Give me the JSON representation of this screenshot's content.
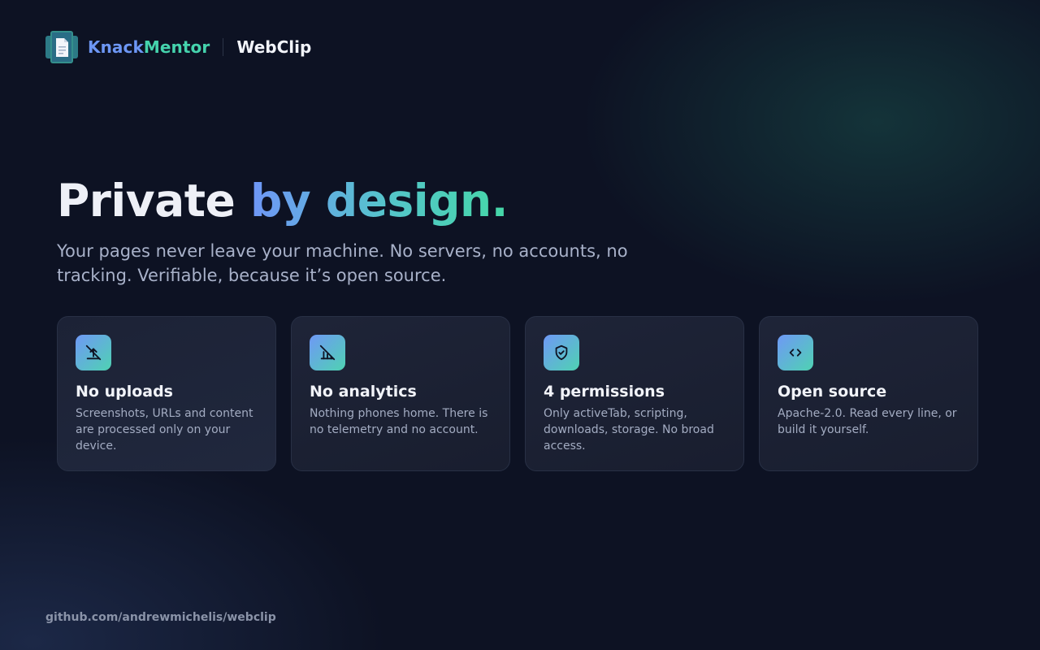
{
  "header": {
    "brand_part1": "Knack",
    "brand_part2": "Mentor",
    "product": "WebClip",
    "logo_icon": "document-logo-icon"
  },
  "hero": {
    "title_plain": "Private ",
    "title_accent": "by design.",
    "subtitle": "Your pages never leave your machine. No servers, no accounts, no tracking. Verifiable, because it’s open source."
  },
  "cards": [
    {
      "icon": "no-upload-icon",
      "title": "No uploads",
      "description": "Screenshots, URLs and content are processed only on your device."
    },
    {
      "icon": "no-analytics-icon",
      "title": "No analytics",
      "description": "Nothing phones home. There is no telemetry and no account."
    },
    {
      "icon": "shield-check-icon",
      "title": "4 permissions",
      "description": "Only activeTab, scripting, downloads, storage. No broad access."
    },
    {
      "icon": "code-icon",
      "title": "Open source",
      "description": "Apache-2.0. Read every line, or build it yourself."
    }
  ],
  "footer": {
    "link": "github.com/andrewmichelis/webclip"
  },
  "colors": {
    "background": "#0d1223",
    "accent_blue": "#6d97f5",
    "accent_green": "#45d3ad",
    "card_border": "#283045",
    "text_muted": "#a8b1c9"
  }
}
